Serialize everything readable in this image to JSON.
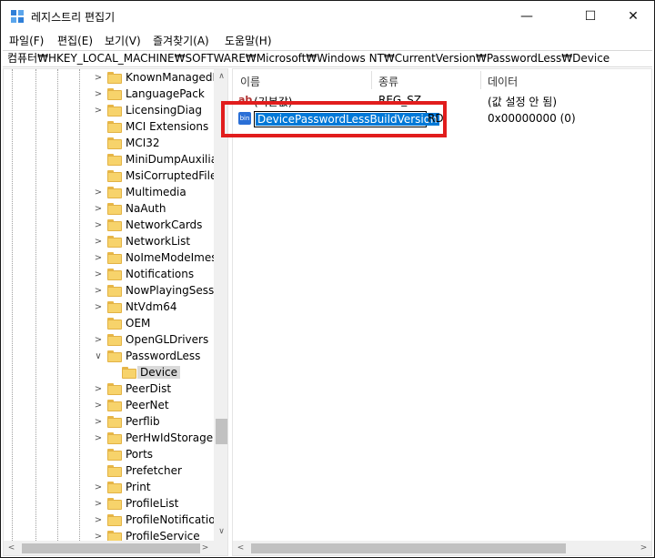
{
  "window": {
    "title": "레지스트리 편집기",
    "minimize": "—",
    "maximize": "☐",
    "close": "✕"
  },
  "menu": [
    "파일(F)",
    "편집(E)",
    "보기(V)",
    "즐겨찾기(A)",
    "도움말(H)"
  ],
  "address": "컴퓨터₩HKEY_LOCAL_MACHINE₩SOFTWARE₩Microsoft₩Windows NT₩CurrentVersion₩PasswordLess₩Device",
  "tree": {
    "items": [
      {
        "label": "KnownManagedD",
        "expander": ">"
      },
      {
        "label": "LanguagePack",
        "expander": ">"
      },
      {
        "label": "LicensingDiag",
        "expander": ">"
      },
      {
        "label": "MCI Extensions",
        "expander": ""
      },
      {
        "label": "MCI32",
        "expander": ""
      },
      {
        "label": "MiniDumpAuxiliar",
        "expander": ""
      },
      {
        "label": "MsiCorruptedFileR",
        "expander": ""
      },
      {
        "label": "Multimedia",
        "expander": ">"
      },
      {
        "label": "NaAuth",
        "expander": ">"
      },
      {
        "label": "NetworkCards",
        "expander": ">"
      },
      {
        "label": "NetworkList",
        "expander": ">"
      },
      {
        "label": "NoImeModeImes",
        "expander": ">"
      },
      {
        "label": "Notifications",
        "expander": ">"
      },
      {
        "label": "NowPlayingSessio",
        "expander": ">"
      },
      {
        "label": "NtVdm64",
        "expander": ">"
      },
      {
        "label": "OEM",
        "expander": ""
      },
      {
        "label": "OpenGLDrivers",
        "expander": ">"
      },
      {
        "label": "PasswordLess",
        "expander": "∨"
      },
      {
        "label": "Device",
        "expander": "",
        "child": true
      },
      {
        "label": "PeerDist",
        "expander": ">"
      },
      {
        "label": "PeerNet",
        "expander": ">"
      },
      {
        "label": "Perflib",
        "expander": ">"
      },
      {
        "label": "PerHwIdStorage",
        "expander": ">"
      },
      {
        "label": "Ports",
        "expander": ""
      },
      {
        "label": "Prefetcher",
        "expander": ""
      },
      {
        "label": "Print",
        "expander": ">"
      },
      {
        "label": "ProfileList",
        "expander": ">"
      },
      {
        "label": "ProfileNotification",
        "expander": ">"
      },
      {
        "label": "ProfileService",
        "expander": ">"
      }
    ]
  },
  "list": {
    "headers": {
      "name": "이름",
      "type": "종류",
      "data": "데이터"
    },
    "rows": [
      {
        "icon": "ab",
        "name": "(기본값)",
        "type": "REG_SZ",
        "data": "(값 설정 안 됨)"
      },
      {
        "icon": "bin",
        "name": "DevicePasswordLessBuildVersion",
        "type": "RD",
        "data": "0x00000000 (0)",
        "editing": true
      }
    ]
  },
  "scroll": {
    "up": "∧",
    "down": "∨",
    "left": "<",
    "right": ">"
  },
  "colors": {
    "highlight": "#e11d1d",
    "selection": "#0078d7"
  }
}
